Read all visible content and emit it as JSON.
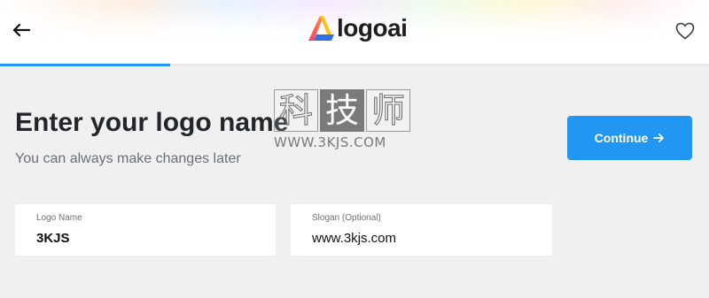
{
  "header": {
    "logo_text": "logoai",
    "back_icon": "arrow-left-icon",
    "favorite_icon": "heart-outline-icon",
    "progress": 0.24,
    "accent": "#2196f3"
  },
  "main": {
    "title": "Enter your logo name",
    "subtitle": "You can always make changes later",
    "continue_label": "Continue"
  },
  "fields": {
    "logo_name": {
      "label": "Logo Name",
      "value": "3KJS"
    },
    "slogan": {
      "label": "Slogan (Optional)",
      "value": "www.3kjs.com"
    }
  },
  "watermark": {
    "chars": [
      "科",
      "技",
      "师"
    ],
    "url": "WWW.3KJS.COM"
  }
}
